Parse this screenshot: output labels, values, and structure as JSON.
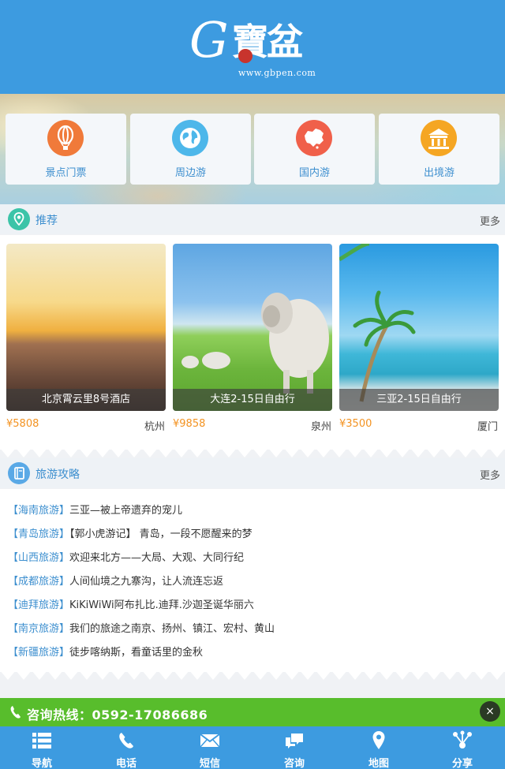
{
  "header": {
    "logo_g": "G",
    "logo_cn": "寶盆",
    "logo_url": "www.gbpen.com"
  },
  "categories": [
    {
      "label": "景点门票",
      "icon": "balloon-icon",
      "color": "#f07a3a"
    },
    {
      "label": "周边游",
      "icon": "globe-icon",
      "color": "#4db7ea"
    },
    {
      "label": "国内游",
      "icon": "china-map-icon",
      "color": "#f0604a"
    },
    {
      "label": "出境游",
      "icon": "temple-icon",
      "color": "#f5a623"
    }
  ],
  "recommend": {
    "title": "推荐",
    "more": "更多",
    "items": [
      {
        "caption": "北京霄云里8号酒店",
        "price": "¥5808",
        "city": "杭州"
      },
      {
        "caption": "大连2-15日自由行",
        "price": "¥9858",
        "city": "泉州"
      },
      {
        "caption": "三亚2-15日自由行",
        "price": "¥3500",
        "city": "厦门"
      }
    ]
  },
  "guides": {
    "title": "旅游攻略",
    "more": "更多",
    "items": [
      {
        "tag": "【海南旅游】",
        "text": "三亚—被上帝遗弃的宠儿"
      },
      {
        "tag": "【青岛旅游】",
        "text": "【郭小虎游记】 青岛，一段不愿醒来的梦"
      },
      {
        "tag": "【山西旅游】",
        "text": "欢迎来北方——大局、大观、大同行纪"
      },
      {
        "tag": "【成都旅游】",
        "text": "人间仙境之九寨沟，让人流连忘返"
      },
      {
        "tag": "【迪拜旅游】",
        "text": "KiKiWiWi阿布扎比.迪拜.沙迦圣诞华丽六"
      },
      {
        "tag": "【南京旅游】",
        "text": "我们的旅途之南京、扬州、镇江、宏村、黄山"
      },
      {
        "tag": "【新疆旅游】",
        "text": "徒步喀纳斯，看童话里的金秋"
      }
    ]
  },
  "hotline": {
    "text": "咨询热线：0592-17086686",
    "close": "×"
  },
  "nav": [
    {
      "label": "导航",
      "icon": "menu-icon"
    },
    {
      "label": "电话",
      "icon": "phone-icon"
    },
    {
      "label": "短信",
      "icon": "mail-icon"
    },
    {
      "label": "咨询",
      "icon": "chat-icon"
    },
    {
      "label": "地图",
      "icon": "map-pin-icon"
    },
    {
      "label": "分享",
      "icon": "share-icon"
    }
  ],
  "colors": {
    "primary": "#3d9be0",
    "link": "#3d8fcf",
    "price": "#f39322",
    "hotline": "#58bd2c"
  }
}
